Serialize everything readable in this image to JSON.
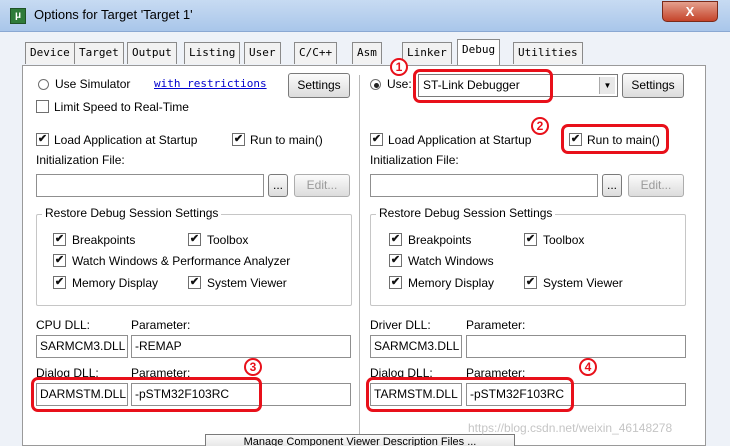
{
  "window": {
    "title": "Options for Target 'Target 1'",
    "close_label": "X"
  },
  "tabs": [
    {
      "label": "Device"
    },
    {
      "label": "Target"
    },
    {
      "label": "Output"
    },
    {
      "label": "Listing"
    },
    {
      "label": "User"
    },
    {
      "label": "C/C++"
    },
    {
      "label": "Asm"
    },
    {
      "label": "Linker"
    },
    {
      "label": "Debug",
      "active": true
    },
    {
      "label": "Utilities"
    }
  ],
  "left": {
    "use_simulator_label": "Use Simulator",
    "with_restrictions_link": "with restrictions",
    "settings_label": "Settings",
    "limit_speed_label": "Limit Speed to Real-Time",
    "load_app_label": "Load Application at Startup",
    "run_to_main_label": "Run to main()",
    "init_file_label": "Initialization File:",
    "browse_label": "...",
    "edit_label": "Edit...",
    "restore_group_title": "Restore Debug Session Settings",
    "breakpoints_label": "Breakpoints",
    "toolbox_label": "Toolbox",
    "watch_label": "Watch Windows & Performance Analyzer",
    "memory_label": "Memory Display",
    "system_viewer_label": "System Viewer",
    "cpu_dll_label": "CPU DLL:",
    "cpu_param_label": "Parameter:",
    "cpu_dll_value": "SARMCM3.DLL",
    "cpu_param_value": "-REMAP",
    "dialog_dll_label": "Dialog DLL:",
    "dialog_param_label": "Parameter:",
    "dialog_dll_value": "DARMSTM.DLL",
    "dialog_param_value": "-pSTM32F103RC"
  },
  "right": {
    "use_label": "Use:",
    "debugger_value": "ST-Link Debugger",
    "settings_label": "Settings",
    "load_app_label": "Load Application at Startup",
    "run_to_main_label": "Run to main()",
    "init_file_label": "Initialization File:",
    "browse_label": "...",
    "edit_label": "Edit...",
    "restore_group_title": "Restore Debug Session Settings",
    "breakpoints_label": "Breakpoints",
    "toolbox_label": "Toolbox",
    "watch_label": "Watch Windows",
    "memory_label": "Memory Display",
    "system_viewer_label": "System Viewer",
    "driver_dll_label": "Driver DLL:",
    "driver_param_label": "Parameter:",
    "driver_dll_value": "SARMCM3.DLL",
    "driver_param_value": "",
    "dialog_dll_label": "Dialog DLL:",
    "dialog_param_label": "Parameter:",
    "dialog_dll_value": "TARMSTM.DLL",
    "dialog_param_value": "-pSTM32F103RC"
  },
  "check_glyph": "✔",
  "annotations": {
    "m1": "1",
    "m2": "2",
    "m3": "3",
    "m4": "4"
  },
  "bottom_button_label": "Manage Component Viewer Description Files ...",
  "watermark": "https://blog.csdn.net/weixin_46148278",
  "colors": {
    "annotation_red": "#e8101a",
    "link_blue": "#0000cc"
  }
}
